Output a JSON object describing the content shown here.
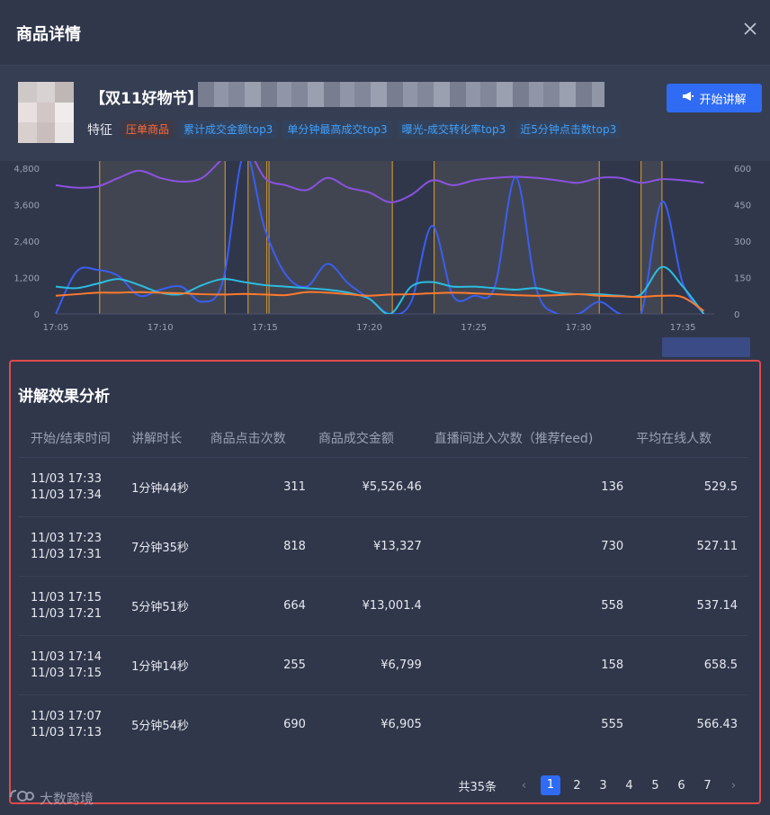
{
  "modal": {
    "title": "商品详情"
  },
  "product": {
    "title": "【双11好物节】",
    "feature_label": "特征",
    "tags": [
      {
        "text": "压单商品",
        "type": "red"
      },
      {
        "text": "累计成交金额top3",
        "type": "blue"
      },
      {
        "text": "单分钟最高成交top3",
        "type": "blue"
      },
      {
        "text": "曝光-成交转化率top3",
        "type": "blue"
      },
      {
        "text": "近5分钟点击数top3",
        "type": "blue"
      }
    ],
    "start_button": "开始讲解"
  },
  "colors": {
    "accent": "#2f6bf3",
    "highlight_border": "#e04a4a",
    "tag_red": "#ff6b3d",
    "tag_blue": "#3fa1ff"
  },
  "chart_data": {
    "type": "line",
    "x_ticks": [
      "17:05",
      "17:10",
      "17:15",
      "17:20",
      "17:25",
      "17:30",
      "17:35"
    ],
    "y_left_ticks": [
      "0",
      "1,200",
      "2,400",
      "3,600",
      "4,800"
    ],
    "y_right_ticks": [
      "0",
      "150",
      "300",
      "450",
      "600"
    ],
    "y_left_range": [
      0,
      4800
    ],
    "y_right_range": [
      0,
      600
    ],
    "x_minutes": [
      5,
      6,
      7,
      8,
      9,
      10,
      11,
      12,
      13,
      14,
      15,
      16,
      17,
      18,
      19,
      20,
      21,
      22,
      23,
      24,
      25,
      26,
      27,
      28,
      29,
      30,
      31,
      32,
      33,
      34,
      35,
      36
    ],
    "series": [
      {
        "color": "#8a52e0",
        "axis": "right",
        "values": [
          530,
          520,
          525,
          560,
          590,
          560,
          545,
          560,
          640,
          700,
          560,
          530,
          510,
          560,
          520,
          500,
          460,
          490,
          550,
          530,
          550,
          560,
          565,
          560,
          550,
          540,
          560,
          560,
          540,
          555,
          550,
          540
        ]
      },
      {
        "color": "#3a5ef0",
        "axis": "left",
        "values": [
          0,
          1400,
          1450,
          1250,
          600,
          800,
          900,
          400,
          1100,
          6000,
          2800,
          1300,
          900,
          1650,
          1000,
          500,
          0,
          400,
          2900,
          600,
          600,
          900,
          4500,
          800,
          0,
          0,
          400,
          0,
          0,
          3700,
          1000,
          0
        ]
      },
      {
        "color": "#2bbde0",
        "axis": "left",
        "values": [
          900,
          850,
          1000,
          1150,
          950,
          700,
          650,
          950,
          1150,
          1050,
          950,
          900,
          850,
          800,
          700,
          500,
          0,
          900,
          1050,
          900,
          900,
          850,
          800,
          850,
          700,
          650,
          650,
          600,
          650,
          1550,
          900,
          0
        ]
      },
      {
        "color": "#ff7a2e",
        "axis": "left",
        "values": [
          600,
          650,
          700,
          700,
          720,
          700,
          680,
          650,
          640,
          660,
          640,
          620,
          720,
          700,
          650,
          600,
          640,
          650,
          680,
          700,
          680,
          650,
          620,
          600,
          620,
          650,
          600,
          580,
          560,
          600,
          550,
          100
        ]
      }
    ],
    "explain_periods": [
      [
        7.1,
        13.1
      ],
      [
        14.2,
        15.1
      ],
      [
        15.2,
        21.1
      ],
      [
        23.1,
        31.0
      ],
      [
        33.0,
        34.0
      ]
    ]
  },
  "analysis": {
    "title": "讲解效果分析",
    "columns": [
      "开始/结束时间",
      "讲解时长",
      "商品点击次数",
      "商品成交金额",
      "直播间进入次数（推荐feed)",
      "平均在线人数"
    ],
    "rows": [
      {
        "start": "11/03 17:33",
        "end": "11/03 17:34",
        "duration": "1分钟44秒",
        "clicks": "311",
        "amount": "¥5,526.46",
        "entries": "136",
        "avg_online": "529.5"
      },
      {
        "start": "11/03 17:23",
        "end": "11/03 17:31",
        "duration": "7分钟35秒",
        "clicks": "818",
        "amount": "¥13,327",
        "entries": "730",
        "avg_online": "527.11"
      },
      {
        "start": "11/03 17:15",
        "end": "11/03 17:21",
        "duration": "5分钟51秒",
        "clicks": "664",
        "amount": "¥13,001.4",
        "entries": "558",
        "avg_online": "537.14"
      },
      {
        "start": "11/03 17:14",
        "end": "11/03 17:15",
        "duration": "1分钟14秒",
        "clicks": "255",
        "amount": "¥6,799",
        "entries": "158",
        "avg_online": "658.5"
      },
      {
        "start": "11/03 17:07",
        "end": "11/03 17:13",
        "duration": "5分钟54秒",
        "clicks": "690",
        "amount": "¥6,905",
        "entries": "555",
        "avg_online": "566.43"
      }
    ]
  },
  "pagination": {
    "total": "共35条",
    "pages": [
      "1",
      "2",
      "3",
      "4",
      "5",
      "6",
      "7"
    ],
    "current": "1"
  },
  "watermark": {
    "text": "大数跨境",
    "icon": "dashuju-logo-icon"
  }
}
